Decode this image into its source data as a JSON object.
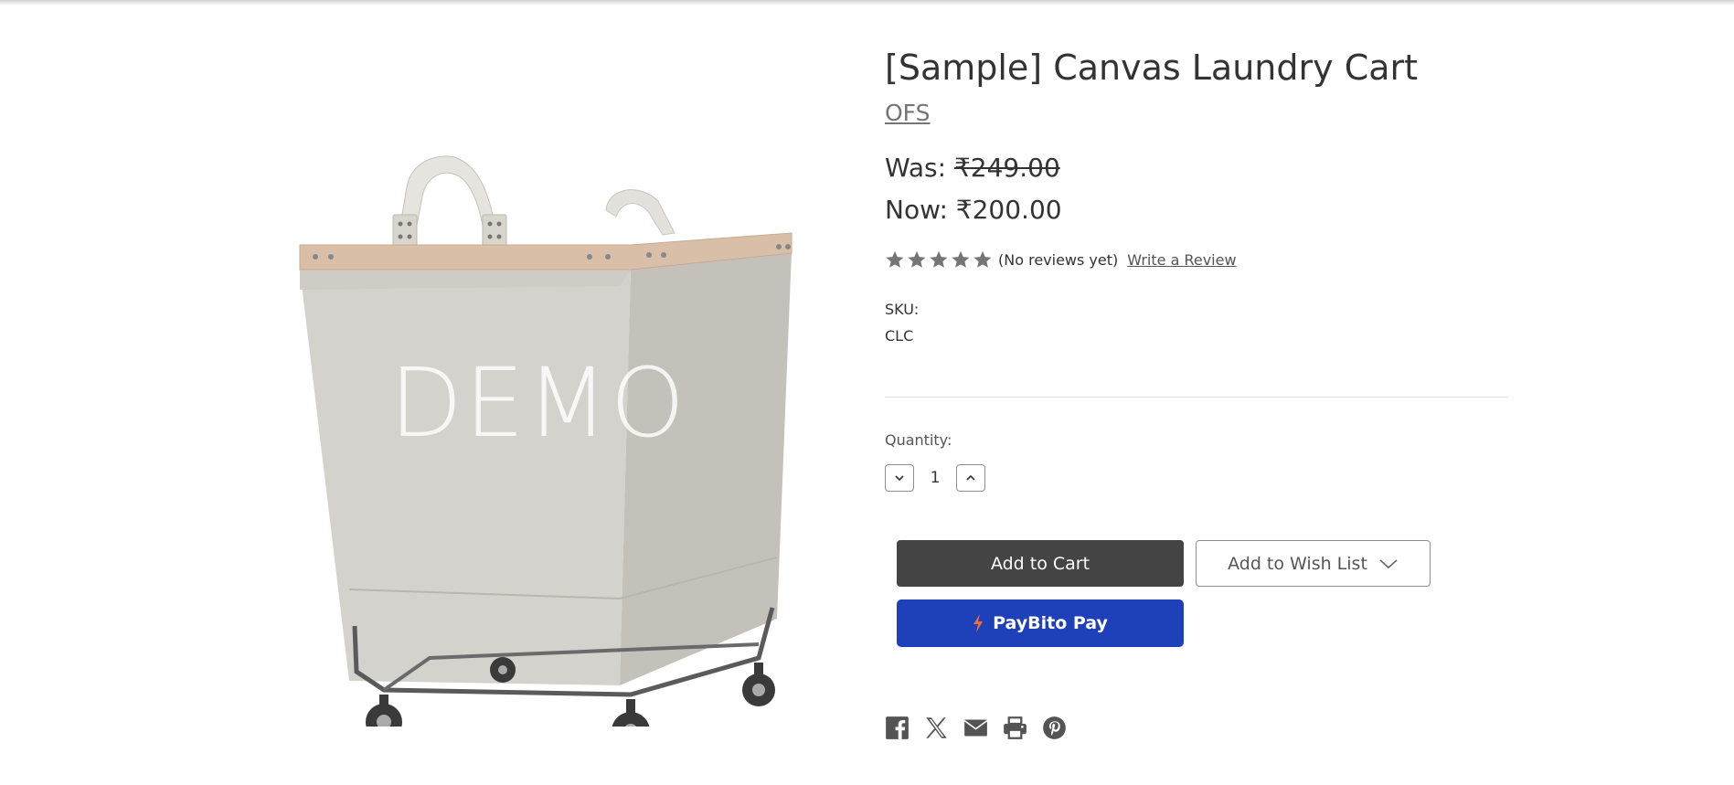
{
  "product": {
    "title": "[Sample] Canvas Laundry Cart",
    "brand": "OFS",
    "image_watermark": "DEMO",
    "price": {
      "was_label": "Was:",
      "was_value": "₹249.00",
      "now_label": "Now:",
      "now_value": "₹200.00"
    },
    "rating": {
      "stars_filled": 0,
      "stars_total": 5,
      "reviews_text": "(No reviews yet)",
      "write_review_label": "Write a Review"
    },
    "sku": {
      "label": "SKU:",
      "value": "CLC"
    },
    "quantity": {
      "label": "Quantity:",
      "value": "1"
    },
    "actions": {
      "add_to_cart": "Add to Cart",
      "add_to_wishlist": "Add to Wish List",
      "paybito": "PayBito Pay"
    },
    "share_icons": [
      "facebook-icon",
      "x-twitter-icon",
      "email-icon",
      "print-icon",
      "pinterest-icon"
    ]
  },
  "colors": {
    "cart_button": "#444444",
    "paybito_button": "#1e40b8",
    "paybito_bolt": "#f26b3a",
    "star": "#757575"
  }
}
